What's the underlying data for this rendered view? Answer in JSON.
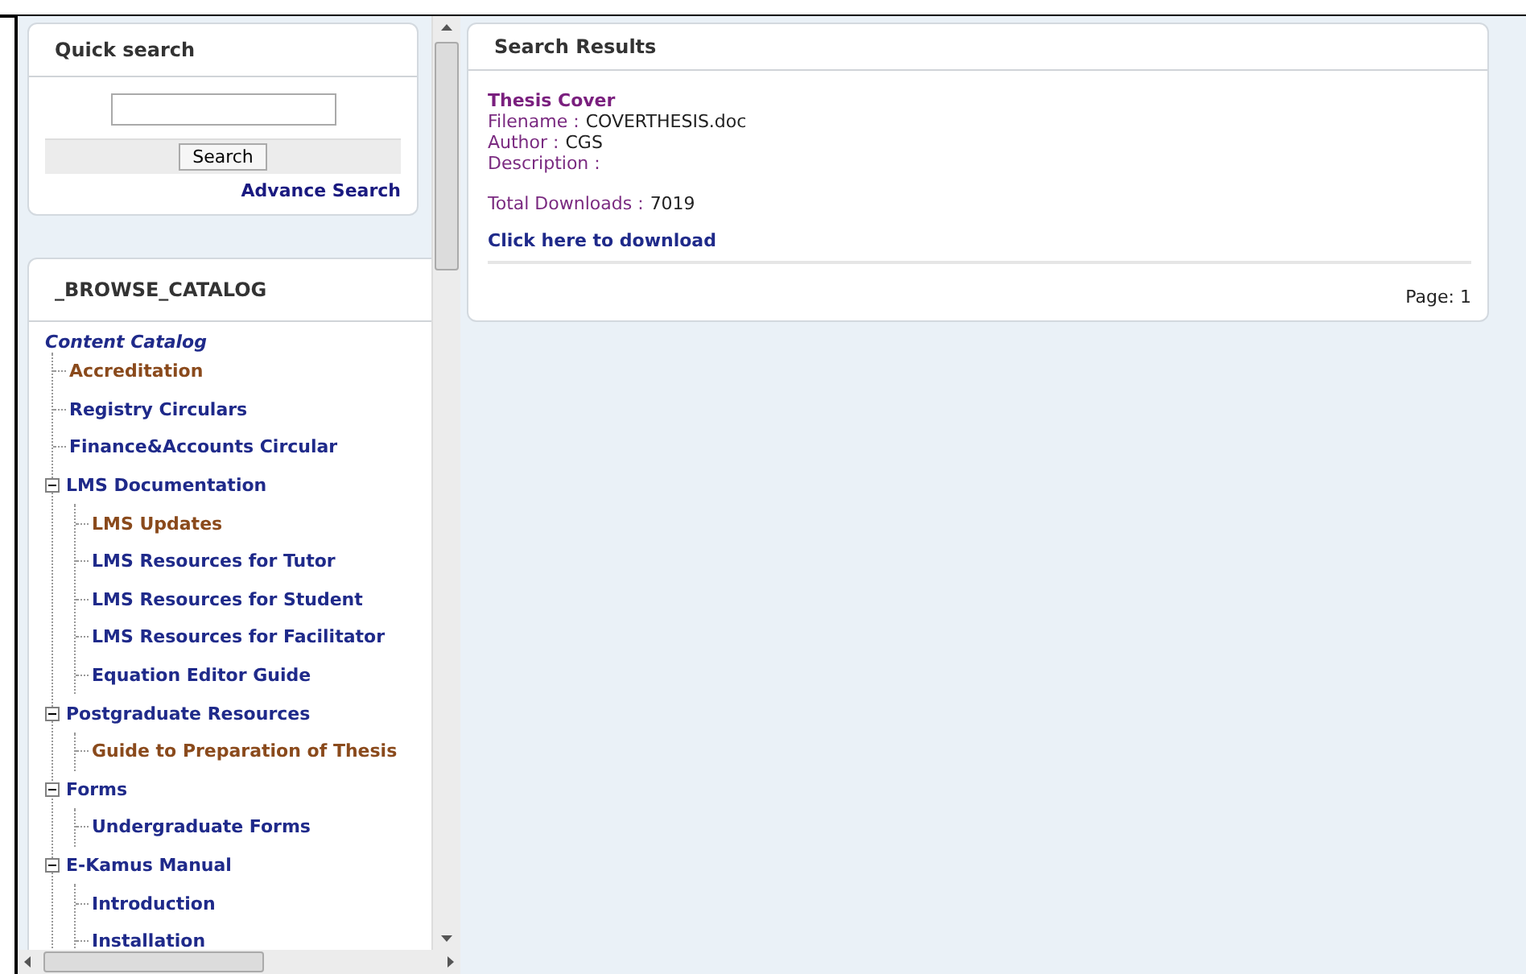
{
  "quick_search": {
    "title": "Quick search",
    "search_button": "Search",
    "advanced_link": "Advance Search"
  },
  "catalog": {
    "title": "_BROWSE_CATALOG",
    "root": "Content Catalog",
    "items": [
      {
        "label": "Accreditation",
        "visited": true
      },
      {
        "label": "Registry Circulars",
        "visited": false
      },
      {
        "label": "Finance&Accounts Circular",
        "visited": false
      },
      {
        "label": "LMS Documentation",
        "visited": false,
        "expanded": true,
        "children": [
          {
            "label": "LMS Updates",
            "visited": true
          },
          {
            "label": "LMS Resources for Tutor",
            "visited": false
          },
          {
            "label": "LMS Resources for Student",
            "visited": false
          },
          {
            "label": "LMS Resources for Facilitator",
            "visited": false
          },
          {
            "label": "Equation Editor Guide",
            "visited": false
          }
        ]
      },
      {
        "label": "Postgraduate Resources",
        "visited": false,
        "expanded": true,
        "children": [
          {
            "label": "Guide to Preparation of Thesis",
            "visited": true
          }
        ]
      },
      {
        "label": "Forms",
        "visited": false,
        "expanded": true,
        "children": [
          {
            "label": "Undergraduate Forms",
            "visited": false
          }
        ]
      },
      {
        "label": "E-Kamus Manual",
        "visited": false,
        "expanded": true,
        "children": [
          {
            "label": "Introduction",
            "visited": false
          },
          {
            "label": "Installation",
            "visited": false
          }
        ]
      }
    ]
  },
  "results": {
    "title": "Search Results",
    "item": {
      "title": "Thesis Cover",
      "fields": [
        {
          "label": "Filename :",
          "value": "COVERTHESIS.doc"
        },
        {
          "label": "Author :",
          "value": "CGS"
        },
        {
          "label": "Description :"
        }
      ],
      "downloads": {
        "label": "Total Downloads :",
        "value": "7019"
      },
      "link": "Click here to download"
    },
    "page": "Page: 1"
  }
}
